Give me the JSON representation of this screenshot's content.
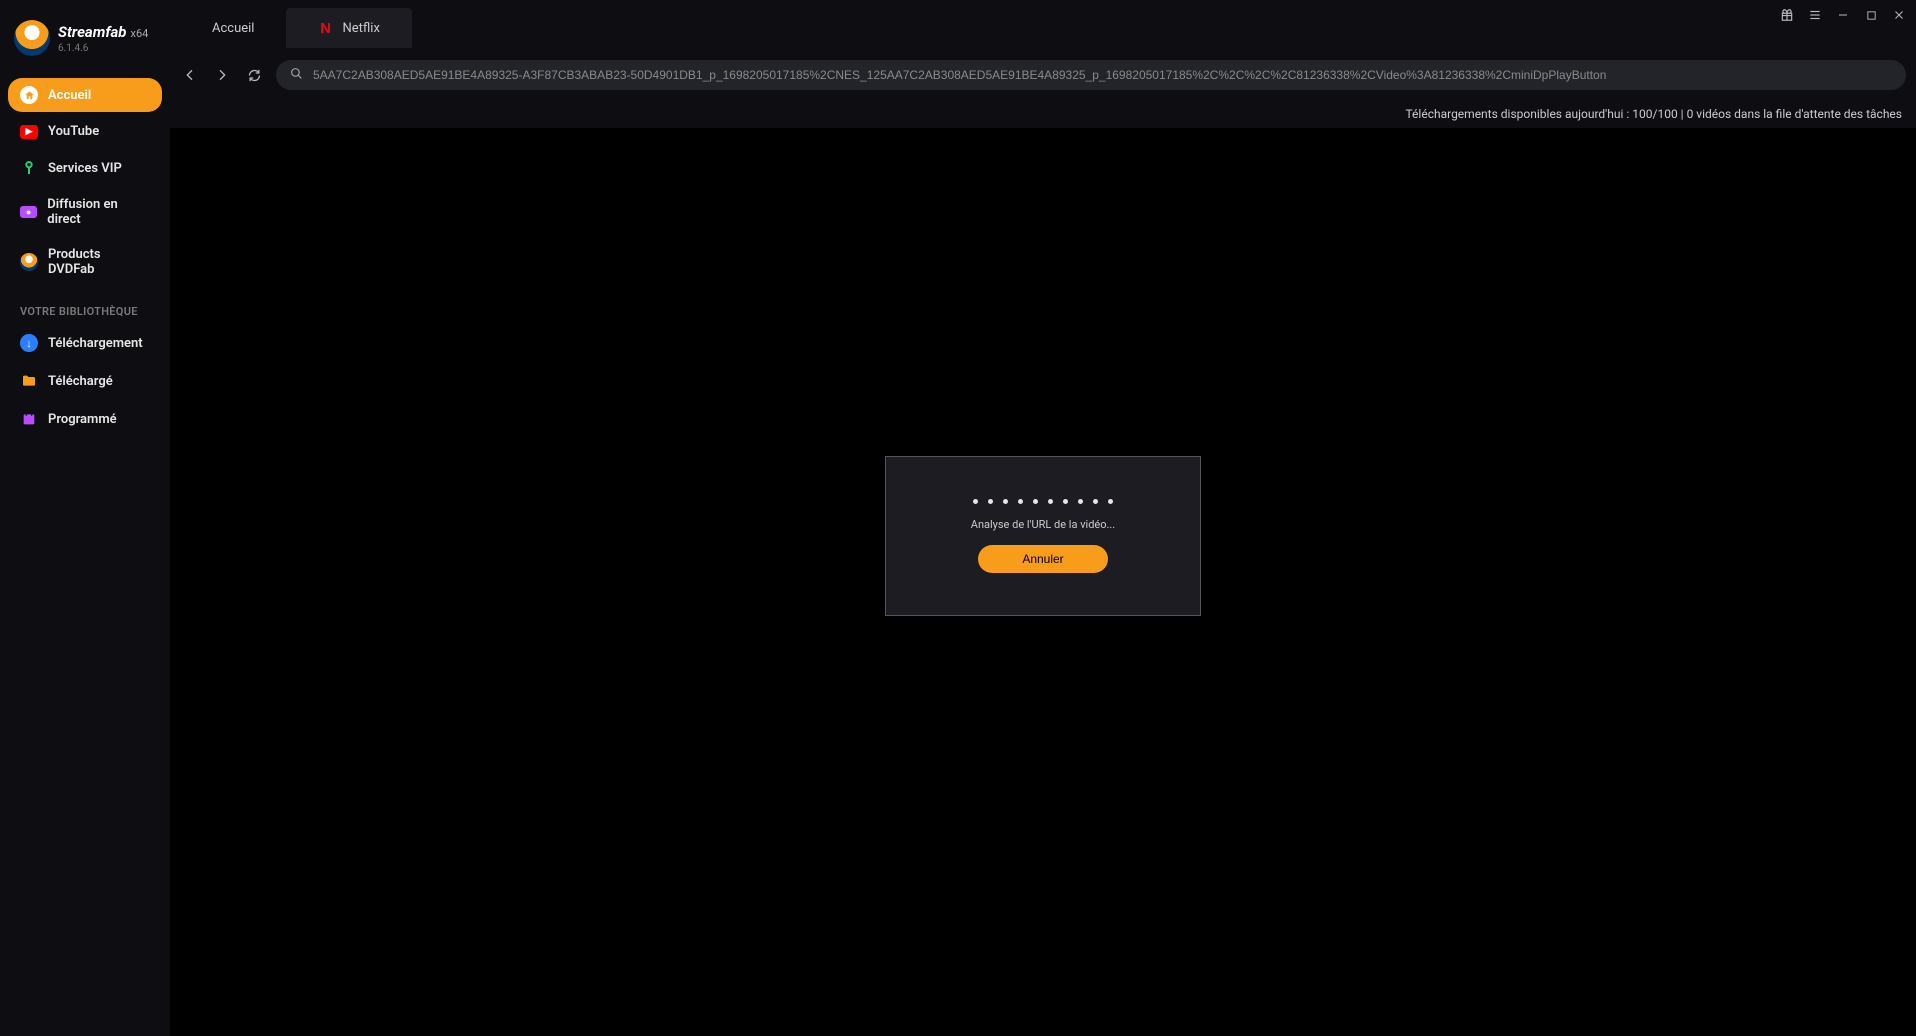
{
  "app": {
    "name": "Streamfab",
    "arch": "x64",
    "version": "6.1.4.6"
  },
  "sidebar": {
    "items": [
      {
        "label": "Accueil"
      },
      {
        "label": "YouTube"
      },
      {
        "label": "Services VIP"
      },
      {
        "label": "Diffusion en direct"
      },
      {
        "label": "Products DVDFab"
      }
    ],
    "library_header": "VOTRE BIBLIOTHÈQUE",
    "library": [
      {
        "label": "Téléchargement"
      },
      {
        "label": "Téléchargé"
      },
      {
        "label": "Programmé"
      }
    ]
  },
  "tabs": [
    {
      "label": "Accueil"
    },
    {
      "label": "Netflix"
    }
  ],
  "urlbar": {
    "value": "5AA7C2AB308AED5AE91BE4A89325-A3F87CB3ABAB23-50D4901DB1_p_1698205017185%2CNES_125AA7C2AB308AED5AE91BE4A89325_p_1698205017185%2C%2C%2C%2C81236338%2CVideo%3A81236338%2CminiDpPlayButton"
  },
  "status": {
    "text": "Téléchargements disponibles aujourd'hui : 100/100 | 0 vidéos dans la file d'attente des tâches"
  },
  "modal": {
    "message": "Analyse de l'URL de la vidéo...",
    "cancel": "Annuler"
  }
}
